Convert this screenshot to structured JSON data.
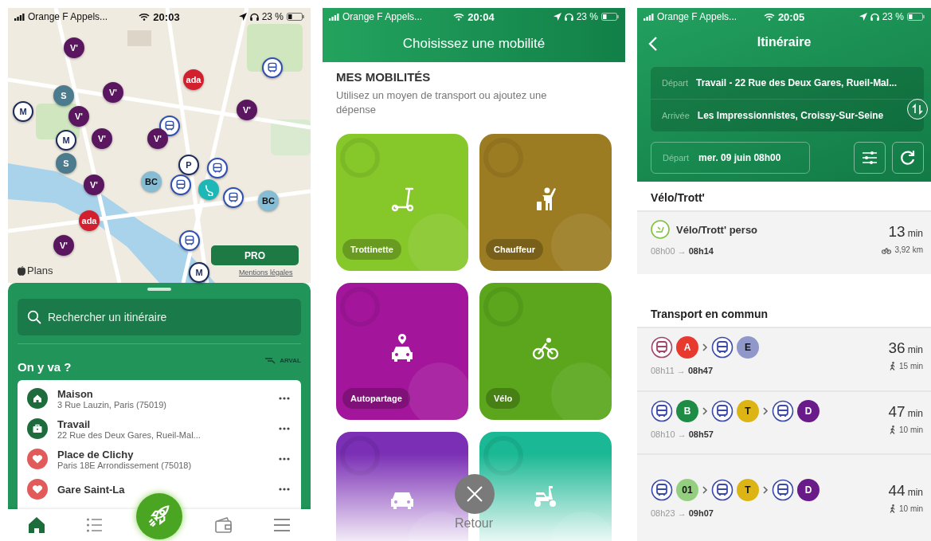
{
  "home_screen": {
    "status_bar": {
      "carrier": "Orange F Appels...",
      "time": "20:03",
      "battery": "23 %"
    },
    "map": {
      "markers": [
        {
          "kind": "velib",
          "label": "V'"
        },
        {
          "kind": "bus"
        },
        {
          "kind": "ada",
          "label": "ada"
        },
        {
          "kind": "s",
          "label": "S"
        },
        {
          "kind": "velib",
          "label": "V'"
        },
        {
          "kind": "metro",
          "label": "M"
        },
        {
          "kind": "velib",
          "label": "V'"
        },
        {
          "kind": "velib",
          "label": "V'"
        },
        {
          "kind": "bus"
        },
        {
          "kind": "metro",
          "label": "M"
        },
        {
          "kind": "velib",
          "label": "V'"
        },
        {
          "kind": "velib",
          "label": "V'"
        },
        {
          "kind": "s",
          "label": "S"
        },
        {
          "kind": "parking",
          "label": "P"
        },
        {
          "kind": "bus"
        },
        {
          "kind": "velib",
          "label": "V'"
        },
        {
          "kind": "bc",
          "label": "BC"
        },
        {
          "kind": "bus"
        },
        {
          "kind": "scooter"
        },
        {
          "kind": "bus"
        },
        {
          "kind": "bc",
          "label": "BC"
        },
        {
          "kind": "ada",
          "label": "ada"
        },
        {
          "kind": "velib",
          "label": "V'"
        },
        {
          "kind": "bus"
        },
        {
          "kind": "metro",
          "label": "M"
        }
      ],
      "pro_button": "PRO",
      "attribution": "Plans",
      "legal_link": "Mentions légales"
    },
    "sheet": {
      "search": {
        "placeholder": "Rechercher un itinéraire"
      },
      "title": "On y va ?",
      "partner_logo": "ARVAL",
      "places": [
        {
          "kind": "home",
          "name": "Maison",
          "address": "3 Rue Lauzin, Paris (75019)",
          "color": "#1e6b3c"
        },
        {
          "kind": "work",
          "name": "Travail",
          "address": "22 Rue des Deux Gares, Rueil-Mal...",
          "color": "#1e6b3c"
        },
        {
          "kind": "favorite",
          "name": "Place de Clichy",
          "address": "Paris 18E Arrondissement (75018)",
          "color": "#e25b5b"
        },
        {
          "kind": "favorite",
          "name": "Gare Saint-La",
          "color": "#e25b5b"
        }
      ]
    },
    "tab_bar": [
      {
        "kind": "home",
        "selected": true
      },
      {
        "kind": "list",
        "selected": false
      },
      {
        "kind": "rocket",
        "selected": false
      },
      {
        "kind": "wallet",
        "selected": false
      },
      {
        "kind": "menu",
        "selected": false
      }
    ]
  },
  "mobility_screen": {
    "status_bar": {
      "carrier": "Orange F Appels...",
      "time": "20:04",
      "battery": "23 %"
    },
    "title": "Choisissez une mobilité",
    "section_title": "MES MOBILITÉS",
    "subtitle": "Utilisez un moyen de transport ou ajoutez une dépense",
    "tiles": [
      {
        "kind": "scooter",
        "label": "Trottinette",
        "color": "#86c72a"
      },
      {
        "kind": "driver",
        "label": "Chauffeur",
        "color": "#9c7c22"
      },
      {
        "kind": "carsharing",
        "label": "Autopartage",
        "color": "#a3169c"
      },
      {
        "kind": "bike",
        "label": "Vélo",
        "color": "#5ba61c"
      },
      {
        "kind": "car",
        "color": "#7b2fb5"
      },
      {
        "kind": "moped",
        "color": "#1ab894"
      }
    ],
    "close_label": "Retour"
  },
  "itinerary_screen": {
    "status_bar": {
      "carrier": "Orange F Appels...",
      "time": "20:05",
      "battery": "23 %"
    },
    "title": "Itinéraire",
    "from": {
      "label": "Départ",
      "value": "Travail - 22 Rue des Deux Gares, Rueil-Mal..."
    },
    "to": {
      "label": "Arrivée",
      "value": "Les Impressionnistes, Croissy-Sur-Seine"
    },
    "departure": {
      "label": "Départ",
      "value": "mer. 09 juin 08h00"
    },
    "sections": [
      {
        "title": "Vélo/Trott'",
        "routes": [
          {
            "kind": "bike",
            "name": "Vélo/Trott' perso",
            "times": "08h00 → **08h14**",
            "duration": "13",
            "unit": "min",
            "detail": "3,92 km"
          }
        ]
      },
      {
        "title": "Transport en commun",
        "routes": [
          {
            "kind": "transit",
            "legs": [
              {
                "kind": "rer",
                "line": "A",
                "color": "#e8392f"
              },
              {
                "kind": "bus",
                "line": "E",
                "color": "#9097c9"
              }
            ],
            "times": "08h11 → **08h47**",
            "duration": "36",
            "unit": "min",
            "detail": "15 min"
          },
          {
            "kind": "transit",
            "legs": [
              {
                "kind": "bus",
                "line": "B",
                "color": "#1e8c45"
              },
              {
                "kind": "bus",
                "line": "T",
                "color": "#dcb414"
              },
              {
                "kind": "bus",
                "line": "D",
                "color": "#6a1b8a"
              }
            ],
            "times": "08h10 → **08h57**",
            "duration": "47",
            "unit": "min",
            "detail": "10 min"
          },
          {
            "kind": "transit",
            "legs": [
              {
                "kind": "bus",
                "line": "01",
                "color": "#93cf7e"
              },
              {
                "kind": "bus",
                "line": "T",
                "color": "#dcb414"
              },
              {
                "kind": "bus",
                "line": "D",
                "color": "#6a1b8a"
              }
            ],
            "times": "08h23 → **09h07**",
            "duration": "44",
            "unit": "min",
            "detail": "10 min"
          }
        ]
      }
    ]
  }
}
